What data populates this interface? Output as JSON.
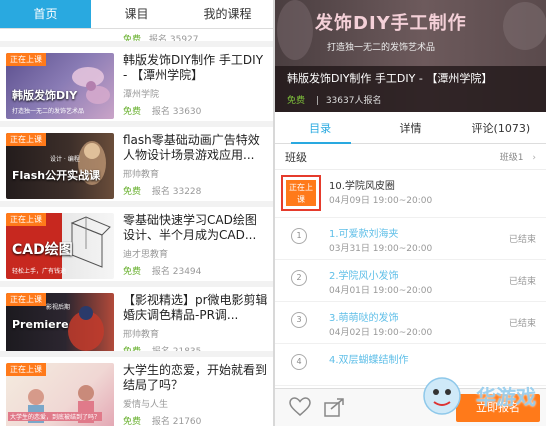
{
  "left": {
    "tabs": [
      "首页",
      "课目",
      "我的课程"
    ],
    "ongoing_label": "正在上课",
    "free_label": "免费",
    "first_partial": {
      "meta": "报名 35927"
    },
    "courses": [
      {
        "thumb_title": "韩版发饰DIY",
        "thumb_sub": "打造独一无二的发饰艺术品",
        "title": "韩版发饰DIY制作 手工DIY - 【潭州学院】",
        "org": "潭州学院",
        "meta": "报名 33630",
        "colors": [
          "#6a5f9a",
          "#d9b6d0"
        ]
      },
      {
        "thumb_title": "Flash公开实战课",
        "thumb_sub": "设计 · 编程",
        "title": "flash零基础动画广告特效人物设计场景游戏应用...",
        "org": "邢帅教育",
        "meta": "报名 33228",
        "colors": [
          "#2a2323",
          "#6a4d3a"
        ]
      },
      {
        "thumb_title": "CAD绘图",
        "thumb_sub": "轻松上手，广有钱途",
        "title": "零基础快速学习CAD绘图设计、半个月成为CAD...",
        "org": "迪才思教育",
        "meta": "报名 23494",
        "colors": [
          "#c7281f",
          "#e6e6e6"
        ]
      },
      {
        "thumb_title": "Premiere",
        "thumb_sub": "影视后期",
        "title": "【影视精选】pr微电影剪辑婚庆调色精品-PR调...",
        "org": "邢帅教育",
        "meta": "报名 21835",
        "colors": [
          "#1c1a1f",
          "#b24a3a"
        ]
      },
      {
        "thumb_title": "",
        "thumb_sub": "大学生的恋爱，到底被结到了吗？",
        "title": "大学生的恋爱，开始就看到结局了吗？",
        "org": "爱情与人生",
        "meta": "报名 21760",
        "colors": [
          "#f2e7d8",
          "#e3a6b3"
        ]
      }
    ]
  },
  "right": {
    "hero_title": "发饰DIY手工制作",
    "hero_sub": "打造独一无二的发饰艺术品",
    "course_title": "韩版发饰DIY制作 手工DIY - 【潭州学院】",
    "free_label": "免费",
    "enroll_count": "33637人报名",
    "tabs": [
      "目录",
      "详情",
      "评论(1073)"
    ],
    "class_label": "班级",
    "class_value": "班级1",
    "live_label": "正在上课",
    "lessons": [
      {
        "num": "",
        "title": "10.学院风皮圈",
        "time": "04月09日 19:00~20:00",
        "status": ""
      },
      {
        "num": "1",
        "title": "1.可爱款刘海夹",
        "time": "03月31日 19:00~20:00",
        "status": "已结束"
      },
      {
        "num": "2",
        "title": "2.学院风小发饰",
        "time": "04月01日 19:00~20:00",
        "status": "已结束"
      },
      {
        "num": "3",
        "title": "3.萌萌哒的发饰",
        "time": "04月02日 19:00~20:00",
        "status": "已结束"
      },
      {
        "num": "4",
        "title": "4.双层蝴蝶结制作",
        "time": "",
        "status": ""
      }
    ],
    "enroll_button": "立即报名",
    "watermark_text": "华游戏"
  }
}
